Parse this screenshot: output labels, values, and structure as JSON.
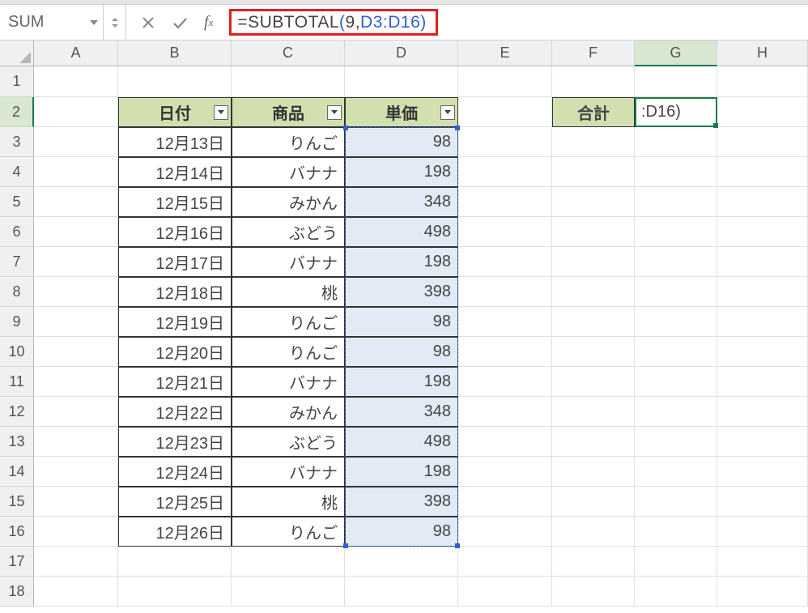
{
  "name_box": "SUM",
  "formula": {
    "prefix": "=SUBTOTAL",
    "open": "(",
    "arg1": "9,",
    "ref": "D3:D16",
    "close": ")"
  },
  "columns": [
    "A",
    "B",
    "C",
    "D",
    "E",
    "F",
    "G",
    "H"
  ],
  "rows": [
    "1",
    "2",
    "3",
    "4",
    "5",
    "6",
    "7",
    "8",
    "9",
    "10",
    "11",
    "12",
    "13",
    "14",
    "15",
    "16",
    "17",
    "18"
  ],
  "headers": {
    "date": "日付",
    "item": "商品",
    "price": "単価",
    "total": "合計"
  },
  "g2_display": ":D16)",
  "data": [
    {
      "date": "12月13日",
      "item": "りんご",
      "price": "98"
    },
    {
      "date": "12月14日",
      "item": "バナナ",
      "price": "198"
    },
    {
      "date": "12月15日",
      "item": "みかん",
      "price": "348"
    },
    {
      "date": "12月16日",
      "item": "ぶどう",
      "price": "498"
    },
    {
      "date": "12月17日",
      "item": "バナナ",
      "price": "198"
    },
    {
      "date": "12月18日",
      "item": "桃",
      "price": "398"
    },
    {
      "date": "12月19日",
      "item": "りんご",
      "price": "98"
    },
    {
      "date": "12月20日",
      "item": "りんご",
      "price": "98"
    },
    {
      "date": "12月21日",
      "item": "バナナ",
      "price": "198"
    },
    {
      "date": "12月22日",
      "item": "みかん",
      "price": "348"
    },
    {
      "date": "12月23日",
      "item": "ぶどう",
      "price": "498"
    },
    {
      "date": "12月24日",
      "item": "バナナ",
      "price": "198"
    },
    {
      "date": "12月25日",
      "item": "桃",
      "price": "398"
    },
    {
      "date": "12月26日",
      "item": "りんご",
      "price": "98"
    }
  ],
  "chart_data": {
    "type": "table",
    "title": "",
    "columns": [
      "日付",
      "商品",
      "単価"
    ],
    "rows": [
      [
        "12月13日",
        "りんご",
        98
      ],
      [
        "12月14日",
        "バナナ",
        198
      ],
      [
        "12月15日",
        "みかん",
        348
      ],
      [
        "12月16日",
        "ぶどう",
        498
      ],
      [
        "12月17日",
        "バナナ",
        198
      ],
      [
        "12月18日",
        "桃",
        398
      ],
      [
        "12月19日",
        "りんご",
        98
      ],
      [
        "12月20日",
        "りんご",
        98
      ],
      [
        "12月21日",
        "バナナ",
        198
      ],
      [
        "12月22日",
        "みかん",
        348
      ],
      [
        "12月23日",
        "ぶどう",
        498
      ],
      [
        "12月24日",
        "バナナ",
        198
      ],
      [
        "12月25日",
        "桃",
        398
      ],
      [
        "12月26日",
        "りんご",
        98
      ]
    ]
  }
}
